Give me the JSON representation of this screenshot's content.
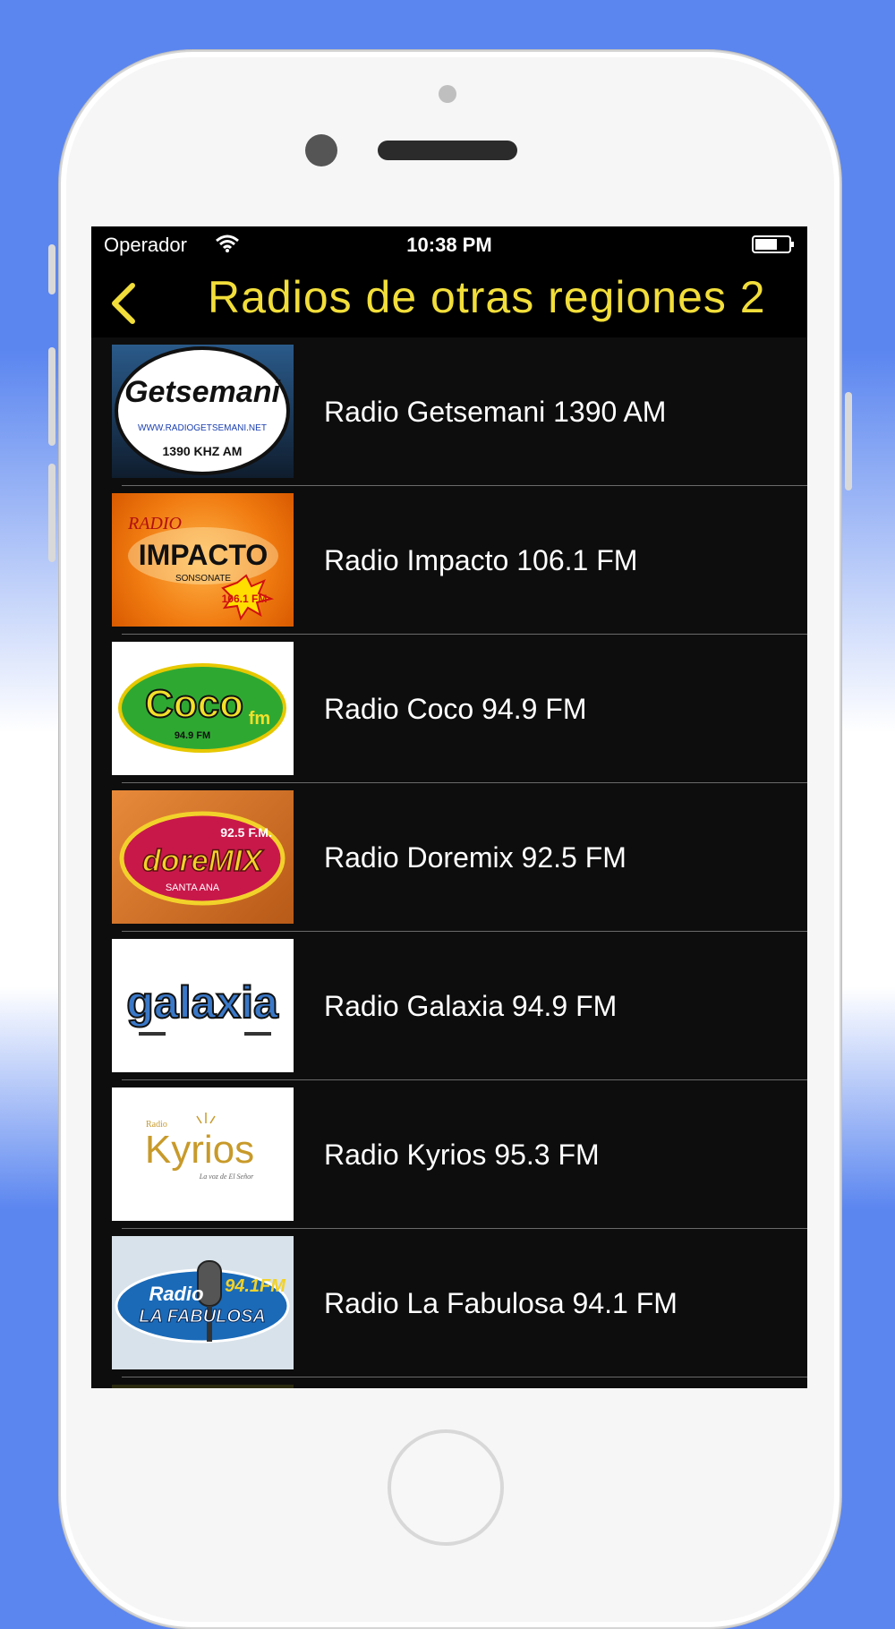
{
  "status_bar": {
    "carrier": "Operador",
    "time": "10:38 PM"
  },
  "nav": {
    "title": "Radios de otras regiones 2"
  },
  "colors": {
    "accent": "#f2de3a",
    "list_bg": "#0d0d0d",
    "page_bg": "#5b86f0"
  },
  "stations": [
    {
      "name": "Radio Getsemani 1390 AM",
      "logo_text": "Getsemani",
      "logo_sub": "1390 KHZ AM",
      "logo_url": "WWW.RADIOGETSEMANI.NET"
    },
    {
      "name": "Radio Impacto 106.1 FM",
      "logo_text": "IMPACTO",
      "logo_top": "RADIO",
      "logo_sub": "SONSONATE",
      "logo_freq": "106.1 FM"
    },
    {
      "name": "Radio Coco 94.9 FM",
      "logo_text": "Coco",
      "logo_fm": "fm",
      "logo_sub": "94.9 FM"
    },
    {
      "name": "Radio Doremix 92.5 FM",
      "logo_text": "doreMIX",
      "logo_freq": "92.5 F.M.",
      "logo_sub": "SANTA ANA"
    },
    {
      "name": "Radio Galaxia 94.9 FM",
      "logo_text": "galaxia"
    },
    {
      "name": "Radio Kyrios 95.3 FM",
      "logo_top": "Radio",
      "logo_text": "Kyrios",
      "logo_sub": "La voz de El Señor"
    },
    {
      "name": "Radio La Fabulosa 94.1 FM",
      "logo_top": "Radio",
      "logo_text": "LA FABULOSA",
      "logo_freq": "94.1FM"
    }
  ]
}
